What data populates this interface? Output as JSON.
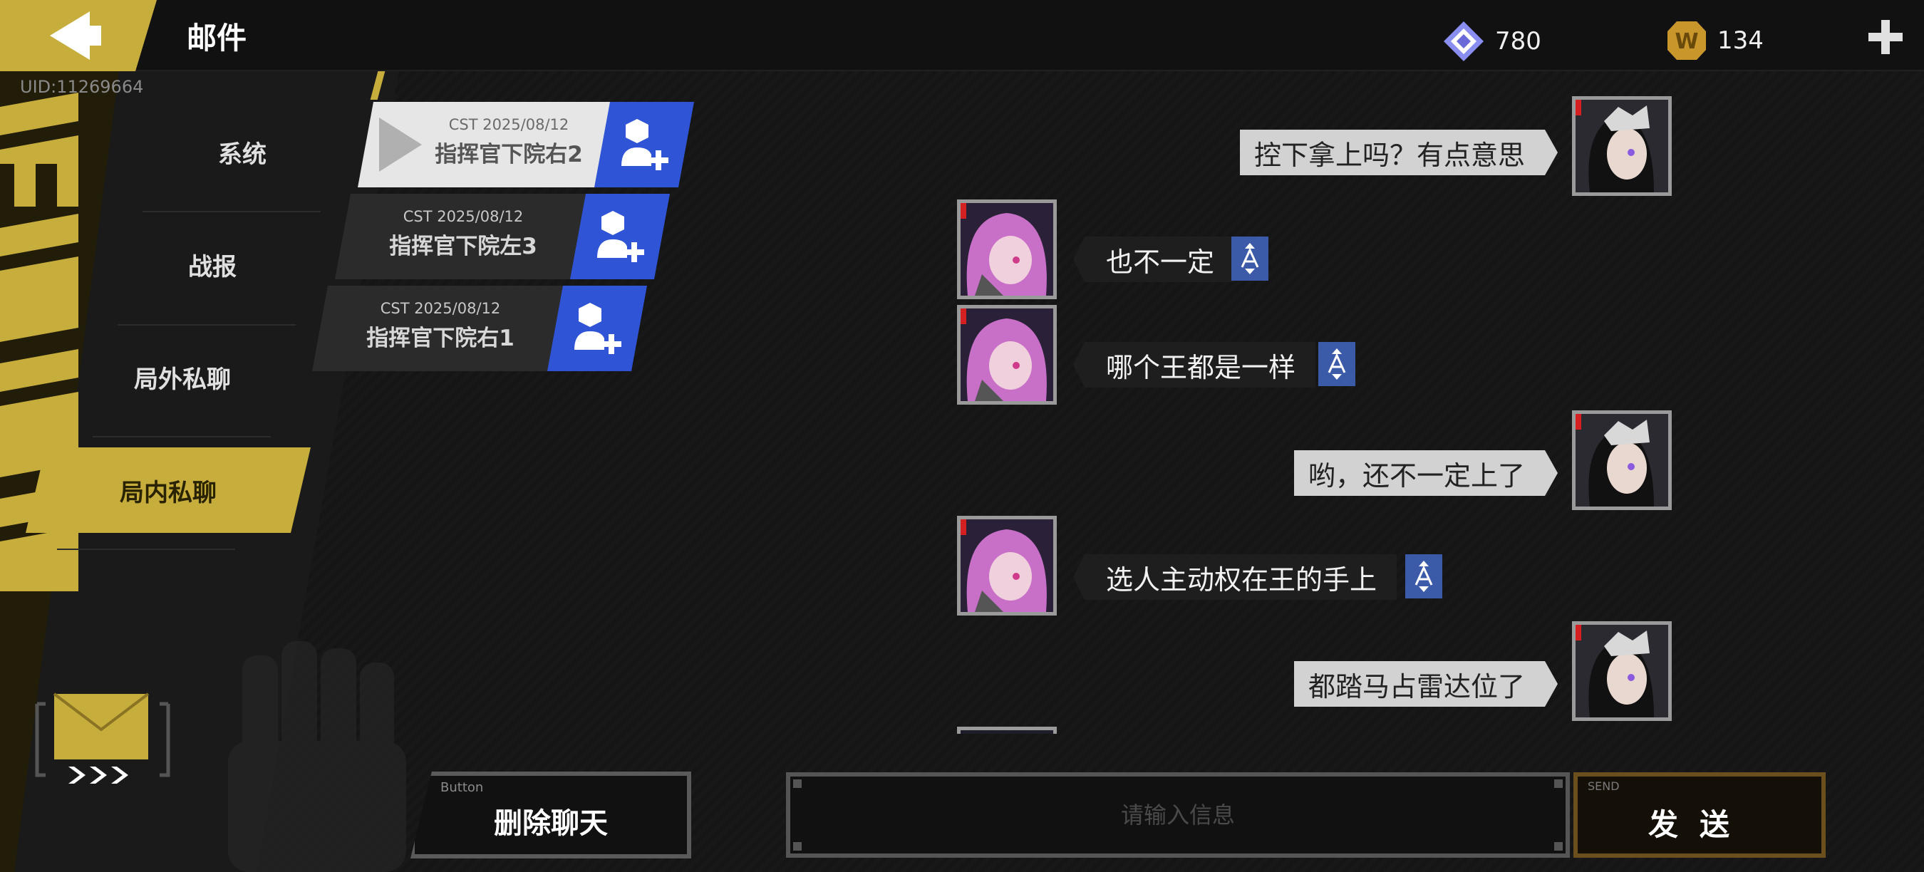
{
  "header": {
    "title": "邮件",
    "uid": "UID:11269664",
    "currencies": [
      {
        "icon": "diamond-gem-icon",
        "value": "780"
      },
      {
        "icon": "gold-w-coin-icon",
        "value": "134"
      }
    ]
  },
  "sidebar": {
    "items": [
      {
        "label": "系统",
        "active": false
      },
      {
        "label": "战报",
        "active": false
      },
      {
        "label": "局外私聊",
        "active": false
      },
      {
        "label": "局内私聊",
        "active": true
      }
    ]
  },
  "mail_list": [
    {
      "date": "CST 2025/08/12",
      "name": "指挥官下院右2",
      "selected": true
    },
    {
      "date": "CST 2025/08/12",
      "name": "指挥官下院左3",
      "selected": false
    },
    {
      "date": "CST 2025/08/12",
      "name": "指挥官下院右1",
      "selected": false
    }
  ],
  "messages": [
    {
      "side": "right",
      "text": "控下拿上吗？有点意思"
    },
    {
      "side": "left",
      "text": "也不一定"
    },
    {
      "side": "left",
      "text": "哪个王都是一样"
    },
    {
      "side": "right",
      "text": "哟，还不一定上了"
    },
    {
      "side": "left",
      "text": "选人主动权在王的手上"
    },
    {
      "side": "right",
      "text": "都踏马占雷达位了"
    }
  ],
  "bottom": {
    "delete_tag": "Button",
    "delete_label": "删除聊天",
    "input_placeholder": "请输入信息",
    "send_tag": "SEND",
    "send_label": "发送"
  },
  "colors": {
    "accent_gold": "#c7ad3c",
    "friend_blue": "#2f55d6",
    "translate_blue": "#3b5aa8",
    "background": "#121212"
  }
}
